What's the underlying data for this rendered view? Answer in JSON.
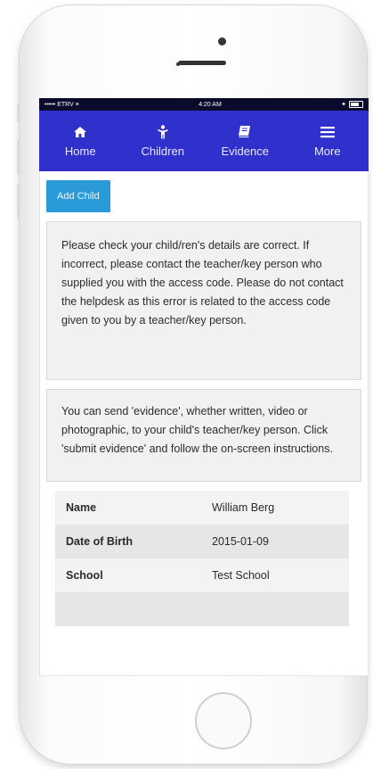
{
  "status_bar": {
    "carrier": "••••• ETRV ≡",
    "time": "4:20 AM",
    "battery_label": "✦"
  },
  "nav": {
    "items": [
      {
        "label": "Home",
        "icon": "home-icon"
      },
      {
        "label": "Children",
        "icon": "child-icon"
      },
      {
        "label": "Evidence",
        "icon": "book-icon"
      },
      {
        "label": "More",
        "icon": "menu-icon"
      }
    ]
  },
  "add_child_label": "Add Child",
  "notice_1": "Please check your child/ren's details are correct. If incorrect, please contact the teacher/key person who supplied you with the access code. Please do not contact the helpdesk as this error is related to the access code given to you by a teacher/key person.",
  "notice_2": "You can send 'evidence', whether written, video or photographic, to your child's teacher/key person. Click 'submit evidence' and follow the on-screen instructions.",
  "details": [
    {
      "label": "Name",
      "value": "William Berg"
    },
    {
      "label": "Date of Birth",
      "value": "2015-01-09"
    },
    {
      "label": "School",
      "value": "Test School"
    },
    {
      "label": "",
      "value": ""
    }
  ],
  "colors": {
    "nav_bg": "#3030cc",
    "button_bg": "#2a9ad9",
    "status_bg": "#0a0a2a"
  }
}
